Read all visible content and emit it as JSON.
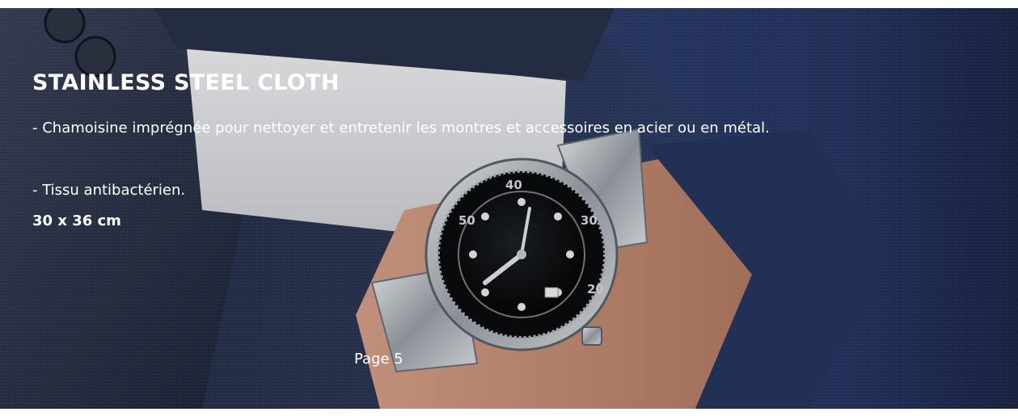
{
  "product": {
    "title": "STAINLESS STEEL CLOTH",
    "description_1": "- Chamoisine imprégnée pour nettoyer et entretenir les montres et accessoires en acier ou en métal.",
    "description_2": "- Tissu antibactérien.",
    "dimensions": "30 x 36 cm"
  },
  "footer": {
    "page_label": "Page 5"
  },
  "image": {
    "subject": "Man in navy suit and white shirt cuff, wearing a stainless steel dive watch with black dial and black bezel, hand in pocket",
    "bezel_numbers": [
      "40",
      "30",
      "20",
      "50"
    ],
    "colors": {
      "suit": "#2b3a63",
      "cuff": "#e8e8ec",
      "steel": "#c7cacf",
      "dial": "#0d0f12"
    }
  }
}
